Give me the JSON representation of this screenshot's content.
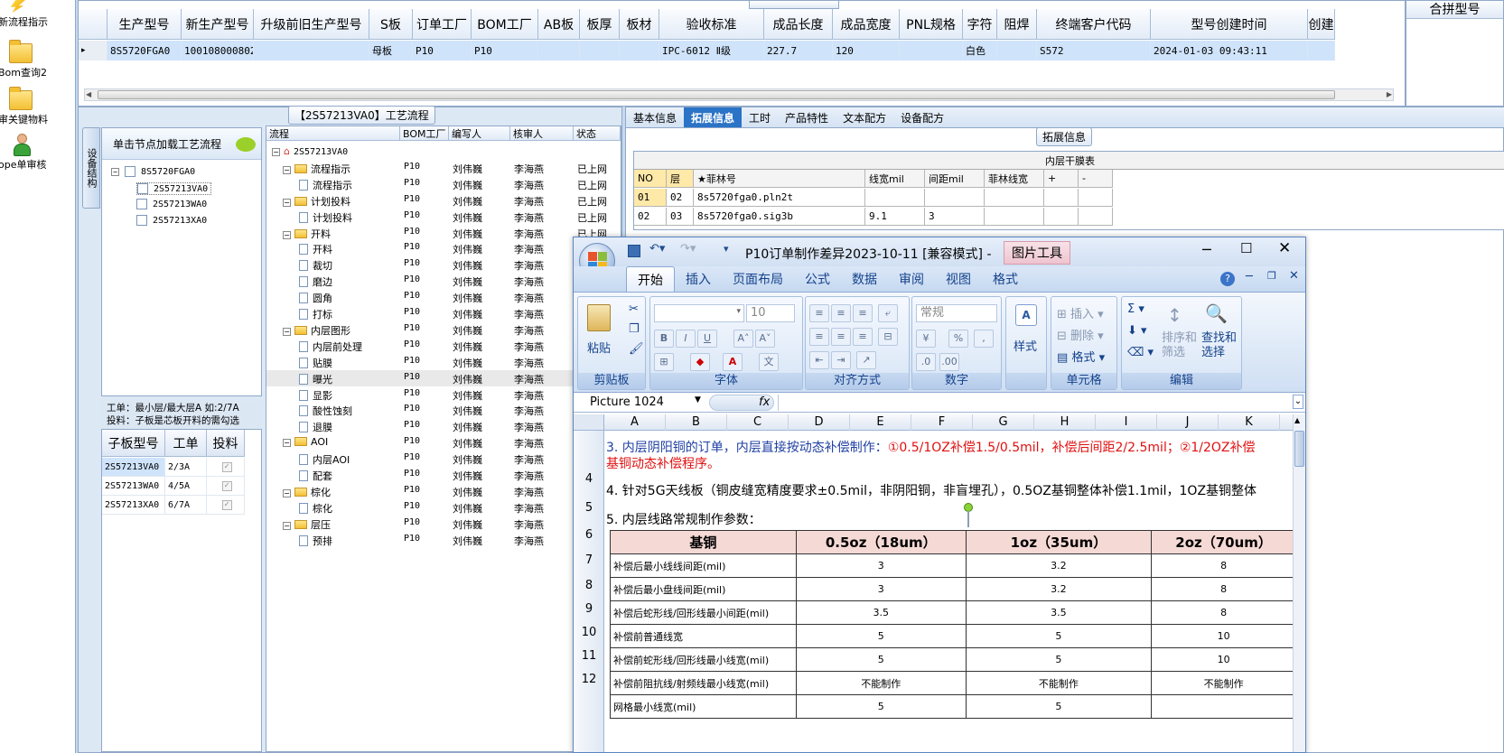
{
  "launcher": [
    {
      "label": "新流程指示",
      "icon": "lightning-icon"
    },
    {
      "label": "Bom查询2",
      "icon": "folder-icon"
    },
    {
      "label": "审关键物料",
      "icon": "folder-icon"
    },
    {
      "label": "ope单审核",
      "icon": "user-icon"
    }
  ],
  "top_grid": {
    "columns": [
      "生产型号",
      "新生产型号",
      "升级前旧生产型号",
      "S板",
      "订单工厂",
      "BOM工厂",
      "AB板",
      "板厚",
      "板材",
      "验收标准",
      "成品长度",
      "成品宽度",
      "PNL规格",
      "字符",
      "阻焊",
      "终端客户代码",
      "型号创建时间",
      "创建"
    ],
    "row": [
      "8S5720FGA0",
      "10010800080238",
      "",
      "母板",
      "P10",
      "P10",
      "",
      "",
      "",
      "IPC-6012 Ⅱ级",
      "227.7",
      "120",
      "",
      "白色",
      "",
      "S572",
      "2024-01-03 09:43:11",
      ""
    ],
    "merge_title": "合拼型号"
  },
  "process_panel": {
    "title": "【2S57213VA0】工艺流程",
    "vertical_tab": "设备结构",
    "tree_hint": "单击节点加载工艺流程",
    "tree": {
      "root": "8S5720FGA0",
      "children": [
        "2S57213VA0",
        "2S57213WA0",
        "2S57213XA0"
      ]
    },
    "notes": [
      "工单：最小层/最大层A 如:2/7A",
      "投料：子板是芯板开料的需勾选"
    ],
    "sub_grid": {
      "columns": [
        "子板型号",
        "工单",
        "投料"
      ],
      "rows": [
        [
          "2S57213VA0",
          "2/3A",
          "✓"
        ],
        [
          "2S57213WA0",
          "4/5A",
          "✓"
        ],
        [
          "2S57213XA0",
          "6/7A",
          "✓"
        ]
      ]
    },
    "flow_grid": {
      "columns": [
        "流程",
        "BOM工厂",
        "编写人",
        "核审人",
        "状态"
      ],
      "rows": [
        {
          "name": "2S57213VA0",
          "level": 0,
          "type": "root",
          "bom": "",
          "writer": "",
          "checker": "",
          "status": ""
        },
        {
          "name": "流程指示",
          "level": 1,
          "type": "folder",
          "bom": "P10",
          "writer": "刘伟巍",
          "checker": "李海燕",
          "status": "已上网"
        },
        {
          "name": "流程指示",
          "level": 2,
          "type": "doc",
          "bom": "P10",
          "writer": "刘伟巍",
          "checker": "李海燕",
          "status": "已上网"
        },
        {
          "name": "计划投料",
          "level": 1,
          "type": "folder",
          "bom": "P10",
          "writer": "刘伟巍",
          "checker": "李海燕",
          "status": "已上网"
        },
        {
          "name": "计划投料",
          "level": 2,
          "type": "doc",
          "bom": "P10",
          "writer": "刘伟巍",
          "checker": "李海燕",
          "status": "已上网"
        },
        {
          "name": "开料",
          "level": 1,
          "type": "folder",
          "bom": "P10",
          "writer": "刘伟巍",
          "checker": "李海燕",
          "status": "已上网"
        },
        {
          "name": "开料",
          "level": 2,
          "type": "doc",
          "bom": "P10",
          "writer": "刘伟巍",
          "checker": "李海燕",
          "status": "已上网"
        },
        {
          "name": "裁切",
          "level": 2,
          "type": "doc",
          "bom": "P10",
          "writer": "刘伟巍",
          "checker": "李海燕",
          "status": "已上网"
        },
        {
          "name": "磨边",
          "level": 2,
          "type": "doc",
          "bom": "P10",
          "writer": "刘伟巍",
          "checker": "李海燕",
          "status": "已上网"
        },
        {
          "name": "圆角",
          "level": 2,
          "type": "doc",
          "bom": "P10",
          "writer": "刘伟巍",
          "checker": "李海燕",
          "status": "已上网"
        },
        {
          "name": "打标",
          "level": 2,
          "type": "doc",
          "bom": "P10",
          "writer": "刘伟巍",
          "checker": "李海燕",
          "status": "已上网"
        },
        {
          "name": "内层图形",
          "level": 1,
          "type": "folder",
          "bom": "P10",
          "writer": "刘伟巍",
          "checker": "李海燕",
          "status": "已上网"
        },
        {
          "name": "内层前处理",
          "level": 2,
          "type": "doc",
          "bom": "P10",
          "writer": "刘伟巍",
          "checker": "李海燕",
          "status": "已上网"
        },
        {
          "name": "贴膜",
          "level": 2,
          "type": "doc",
          "bom": "P10",
          "writer": "刘伟巍",
          "checker": "李海燕",
          "status": "已上网"
        },
        {
          "name": "曝光",
          "level": 2,
          "type": "doc",
          "bom": "P10",
          "writer": "刘伟巍",
          "checker": "李海燕",
          "status": "已上网"
        },
        {
          "name": "显影",
          "level": 2,
          "type": "doc",
          "bom": "P10",
          "writer": "刘伟巍",
          "checker": "李海燕",
          "status": "已上网"
        },
        {
          "name": "酸性蚀刻",
          "level": 2,
          "type": "doc",
          "bom": "P10",
          "writer": "刘伟巍",
          "checker": "李海燕",
          "status": "已上网"
        },
        {
          "name": "退膜",
          "level": 2,
          "type": "doc",
          "bom": "P10",
          "writer": "刘伟巍",
          "checker": "李海燕",
          "status": "已上网"
        },
        {
          "name": "AOI",
          "level": 1,
          "type": "folder",
          "bom": "P10",
          "writer": "刘伟巍",
          "checker": "李海燕",
          "status": "已上网"
        },
        {
          "name": "内层AOI",
          "level": 2,
          "type": "doc",
          "bom": "P10",
          "writer": "刘伟巍",
          "checker": "李海燕",
          "status": "已上网"
        },
        {
          "name": "配套",
          "level": 2,
          "type": "doc",
          "bom": "P10",
          "writer": "刘伟巍",
          "checker": "李海燕",
          "status": "已上网"
        },
        {
          "name": "棕化",
          "level": 1,
          "type": "folder",
          "bom": "P10",
          "writer": "刘伟巍",
          "checker": "李海燕",
          "status": "已上网"
        },
        {
          "name": "棕化",
          "level": 2,
          "type": "doc",
          "bom": "P10",
          "writer": "刘伟巍",
          "checker": "李海燕",
          "status": "已上网"
        },
        {
          "name": "层压",
          "level": 1,
          "type": "folder",
          "bom": "P10",
          "writer": "刘伟巍",
          "checker": "李海燕",
          "status": "已上网"
        },
        {
          "name": "预排",
          "level": 2,
          "type": "doc",
          "bom": "P10",
          "writer": "刘伟巍",
          "checker": "李海燕",
          "status": "已上网"
        }
      ]
    }
  },
  "right_panel": {
    "tabs": [
      "基本信息",
      "拓展信息",
      "工时",
      "产品特性",
      "文本配方",
      "设备配方"
    ],
    "active_tab": "拓展信息",
    "section_title": "拓展信息",
    "inner_title": "内层干膜表",
    "inner_columns": [
      "NO",
      "层",
      "★菲林号",
      "线宽mil",
      "间距mil",
      "菲林线宽",
      "+",
      "-"
    ],
    "inner_rows": [
      [
        "01",
        "02",
        "8s5720fga0.pln2t",
        "",
        "",
        "",
        "",
        ""
      ],
      [
        "02",
        "03",
        "8s5720fga0.sig3b",
        "9.1",
        "3",
        "",
        "",
        ""
      ]
    ]
  },
  "excel": {
    "title": "P10订单制作差异2023-10-11  [兼容模式] -",
    "context_tab": "图片工具",
    "ribbon_tabs": [
      "开始",
      "插入",
      "页面布局",
      "公式",
      "数据",
      "审阅",
      "视图",
      "格式"
    ],
    "groups": [
      "剪贴板",
      "字体",
      "对齐方式",
      "数字",
      "",
      "单元格",
      "编辑"
    ],
    "paste": "粘贴",
    "font_size": "10",
    "number_format": "常规",
    "style": "样式",
    "insert": "插入",
    "delete": "删除",
    "format": "格式",
    "sort": "排序和\n筛选",
    "find": "查找和\n选择",
    "name_box": "Picture 1024",
    "fx": "fx",
    "columns": [
      "A",
      "B",
      "C",
      "D",
      "E",
      "F",
      "G",
      "H",
      "I",
      "J",
      "K"
    ],
    "rows": [
      "4",
      "5",
      "6",
      "7",
      "8",
      "9",
      "10",
      "11",
      "12"
    ],
    "line4_a": "3. 内层阴阳铜的订单，内层直接按动态补偿制作：",
    "line4_b": "①0.5/1OZ补偿1.5/0.5mil，补偿后间距2/2.5mil；②1/2OZ补偿",
    "line4_c": "基铜动态补偿程序。",
    "line5": "4. 针对5G天线板（铜皮缝宽精度要求±0.5mil，非阴阳铜，非盲埋孔），0.5OZ基铜整体补偿1.1mil，1OZ基铜整体",
    "line6": "5. 内层线路常规制作参数：",
    "table_header": [
      "基铜",
      "0.5oz（18um）",
      "1oz（35um）",
      "2oz（70um）"
    ],
    "table_rows": [
      [
        "补偿后最小线线间距(mil)",
        "3",
        "3.2",
        "8"
      ],
      [
        "补偿后最小盘线间距(mil)",
        "3",
        "3.2",
        "8"
      ],
      [
        "补偿后蛇形线/回形线最小间距(mil)",
        "3.5",
        "3.5",
        "8"
      ],
      [
        "补偿前普通线宽",
        "5",
        "5",
        "10"
      ],
      [
        "补偿前蛇形线/回形线最小线宽(mil)",
        "5",
        "5",
        "10"
      ],
      [
        "补偿前阻抗线/射频线最小线宽(mil)",
        "不能制作",
        "不能制作",
        "不能制作"
      ],
      [
        "网格最小线宽(mil)",
        "5",
        "5",
        ""
      ]
    ]
  }
}
